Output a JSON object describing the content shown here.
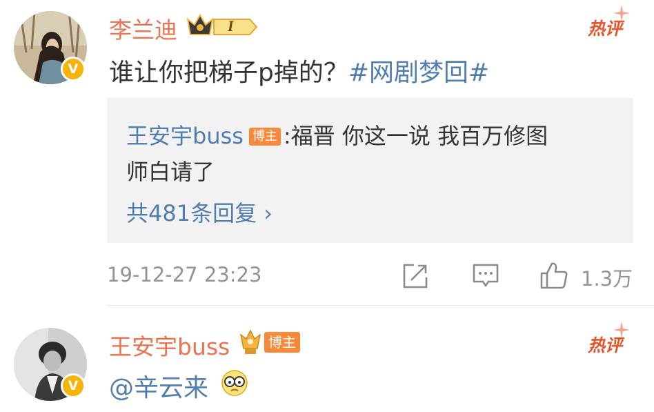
{
  "comment1": {
    "username": "李兰迪",
    "level": "I",
    "verified_badge": "V",
    "hot_label": "热评",
    "text": "谁让你把梯子p掉的？",
    "topic": "#网剧梦回#",
    "reply": {
      "username": "王安宇buss",
      "tag": "博主",
      "text_line1": ":福晋 你这一说 我百万修图",
      "text_line2": "师白请了",
      "more": "共481条回复 ›"
    },
    "timestamp": "19-12-27 23:23",
    "like_count": "1.3万",
    "icons": [
      "share-icon",
      "comment-icon",
      "like-icon"
    ]
  },
  "comment2": {
    "username": "王安宇buss",
    "tag": "博主",
    "verified_badge": "V",
    "hot_label": "热评",
    "text": "@辛云来",
    "emoji": "glasses-emoji"
  },
  "colors": {
    "username": "#eb7350",
    "link": "#507daf",
    "hot": "#e8542a",
    "meta": "#939393",
    "reply_bg": "#f2f2f2",
    "tag_bg": "#f7893b",
    "v_badge": "#f6b40a"
  }
}
